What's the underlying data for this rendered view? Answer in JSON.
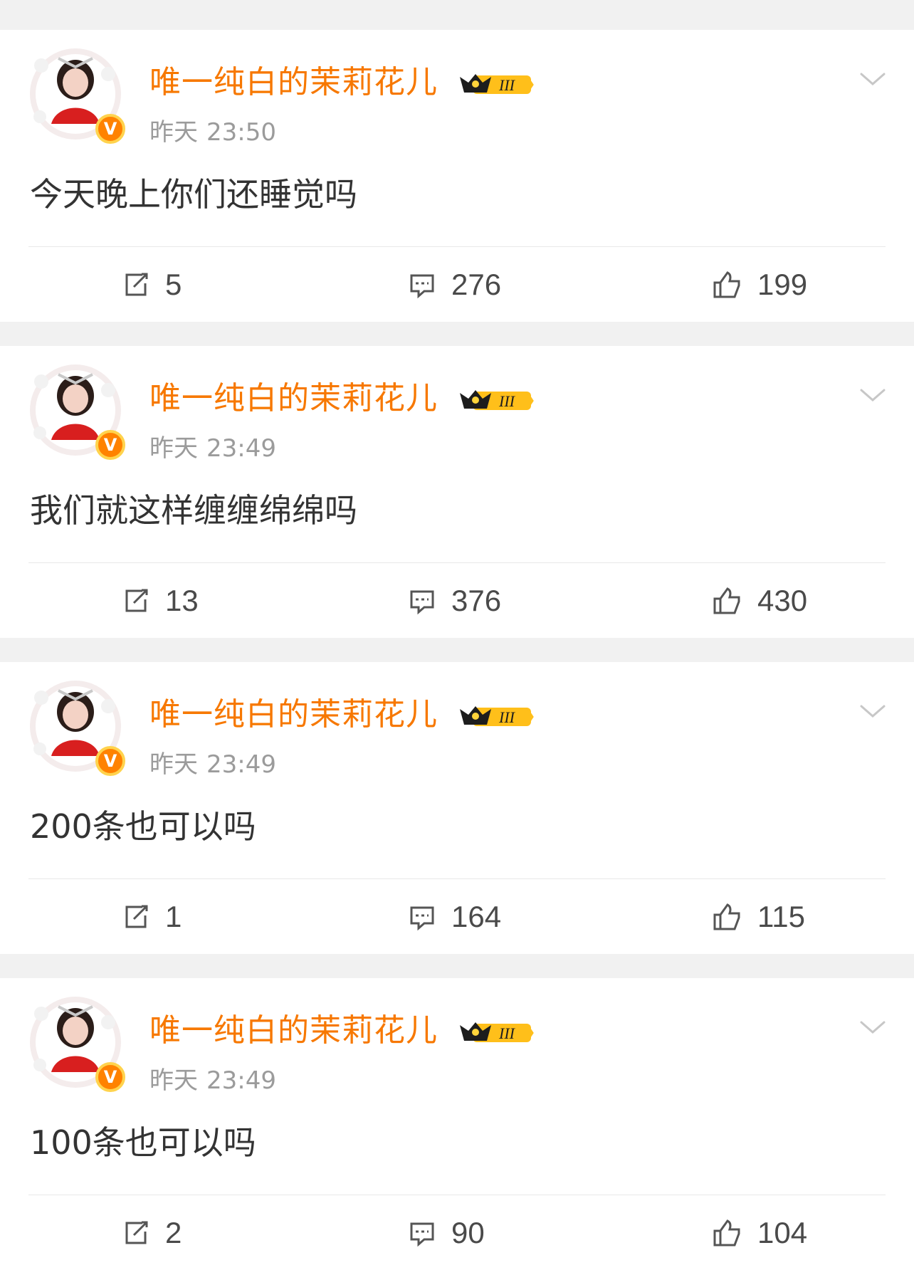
{
  "colors": {
    "username": "#f77800",
    "timestamp": "#9b9b9b",
    "body_text": "#333333",
    "background": "#f1f1f1",
    "card": "#ffffff"
  },
  "icons": {
    "repost": "repost-icon",
    "comment": "comment-icon",
    "like": "thumbs-up-icon",
    "menu": "chevron-down-icon",
    "verified": "verified-v-icon",
    "member": "crown-badge-icon"
  },
  "posts": [
    {
      "username": "唯一纯白的茉莉花儿",
      "member_level": "III",
      "verified_mark": "V",
      "time_day": "昨天",
      "time_clock": "23:50",
      "text": "今天晚上你们还睡觉吗",
      "reposts": "5",
      "comments": "276",
      "likes": "199"
    },
    {
      "username": "唯一纯白的茉莉花儿",
      "member_level": "III",
      "verified_mark": "V",
      "time_day": "昨天",
      "time_clock": "23:49",
      "text": "我们就这样缠缠绵绵吗",
      "reposts": "13",
      "comments": "376",
      "likes": "430"
    },
    {
      "username": "唯一纯白的茉莉花儿",
      "member_level": "III",
      "verified_mark": "V",
      "time_day": "昨天",
      "time_clock": "23:49",
      "text": "200条也可以吗",
      "reposts": "1",
      "comments": "164",
      "likes": "115"
    },
    {
      "username": "唯一纯白的茉莉花儿",
      "member_level": "III",
      "verified_mark": "V",
      "time_day": "昨天",
      "time_clock": "23:49",
      "text": "100条也可以吗",
      "reposts": "2",
      "comments": "90",
      "likes": "104"
    }
  ]
}
